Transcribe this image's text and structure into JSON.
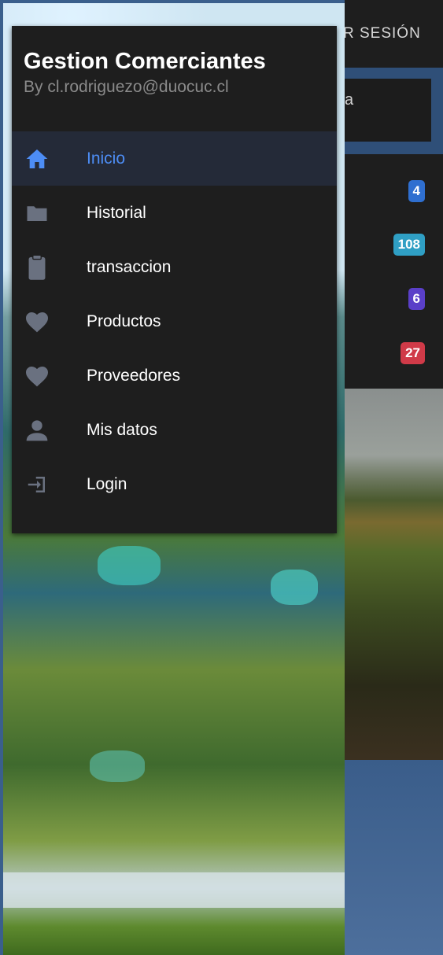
{
  "header": {
    "logout_label": "R SESIÓN"
  },
  "search": {
    "partial_text": "a"
  },
  "badges": [
    {
      "value": "4",
      "color": "#2f6fd0"
    },
    {
      "value": "108",
      "color": "#2f9fc4"
    },
    {
      "value": "6",
      "color": "#5a3fc8"
    },
    {
      "value": "27",
      "color": "#d03a48"
    }
  ],
  "drawer": {
    "title": "Gestion Comerciantes",
    "subtitle": "By cl.rodriguezo@duocuc.cl",
    "items": [
      {
        "label": "Inicio",
        "icon": "home-icon",
        "active": true
      },
      {
        "label": "Historial",
        "icon": "folder-icon"
      },
      {
        "label": "transaccion",
        "icon": "clipboard-icon"
      },
      {
        "label": "Productos",
        "icon": "heart-icon"
      },
      {
        "label": "Proveedores",
        "icon": "heart-icon"
      },
      {
        "label": "Mis datos",
        "icon": "person-icon"
      },
      {
        "label": "Login",
        "icon": "login-icon"
      }
    ]
  },
  "colors": {
    "accent": "#4d8df5",
    "drawer_bg": "#1e1e1e",
    "icon_gray": "#6a7180"
  }
}
